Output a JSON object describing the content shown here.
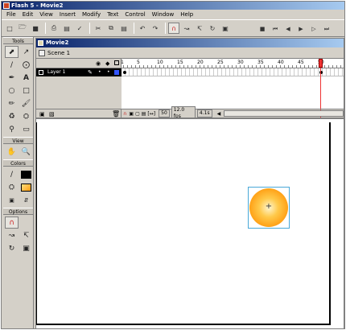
{
  "app": {
    "title": "Flash 5 - Movie2"
  },
  "menu": [
    "File",
    "Edit",
    "View",
    "Insert",
    "Modify",
    "Text",
    "Control",
    "Window",
    "Help"
  ],
  "toolbar": {
    "icons": [
      "new-icon",
      "open-icon",
      "save-icon",
      "print-icon",
      "print-preview-icon",
      "spell-icon",
      "cut-icon",
      "copy-icon",
      "paste-icon",
      "undo-icon",
      "redo-icon",
      "magnet-icon",
      "smooth-icon",
      "straighten-icon",
      "rotate-icon",
      "scale-icon"
    ],
    "controller": [
      "stop-icon",
      "rewind-icon",
      "step-back-icon",
      "play-icon",
      "step-forward-icon",
      "go-to-end-icon"
    ]
  },
  "tools": {
    "header": "Tools",
    "view_header": "View",
    "colors_header": "Colors",
    "options_header": "Options",
    "stroke_color": "#000000",
    "fill_color": "#ffa500"
  },
  "document": {
    "title": "Movie2",
    "scene": "Scene 1"
  },
  "timeline": {
    "ruler_labels": [
      "1",
      "5",
      "10",
      "15",
      "20",
      "25",
      "30",
      "35",
      "40",
      "45",
      "50"
    ],
    "current_frame_label": "50",
    "layers": [
      {
        "name": "Layer 1"
      }
    ],
    "status": {
      "frame": "50",
      "rate": "12.0 fps",
      "time": "4.1s"
    }
  },
  "colors": {
    "title_start": "#0a246a",
    "title_end": "#a6caf0",
    "chrome": "#d4d0c8",
    "playhead": "#e33333",
    "ball_fill": "#ff9c10"
  }
}
